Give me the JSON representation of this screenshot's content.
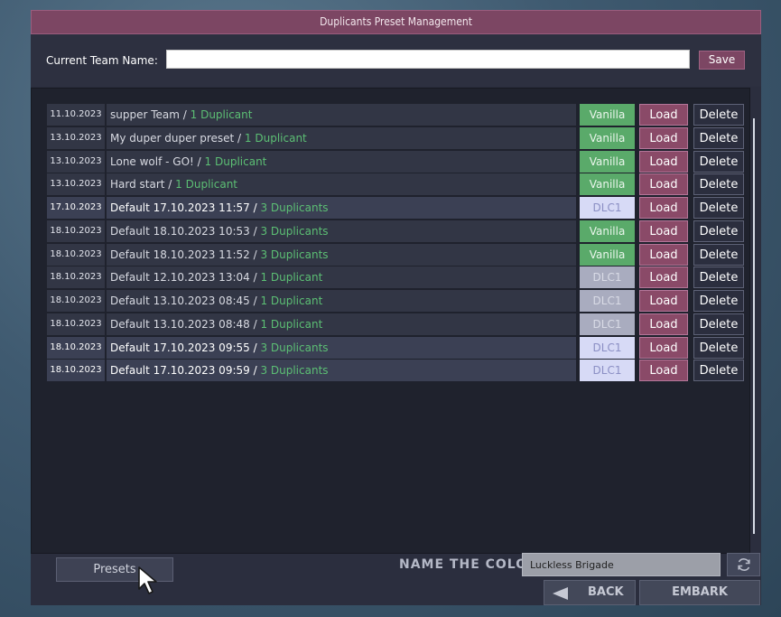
{
  "dialog": {
    "title": "Duplicants Preset Management",
    "team_label": "Current Team Name:",
    "team_value": "",
    "save_label": "Save"
  },
  "presets": [
    {
      "date": "11.10.2023",
      "name": "supper Team",
      "sep": " / ",
      "count": "1 Duplicant",
      "dlc": "Vanilla",
      "load": "Load",
      "delete": "Delete"
    },
    {
      "date": "13.10.2023",
      "name": "My duper duper preset",
      "sep": " / ",
      "count": "1 Duplicant",
      "dlc": "Vanilla",
      "load": "Load",
      "delete": "Delete"
    },
    {
      "date": "13.10.2023",
      "name": "Lone wolf - GO!",
      "sep": " / ",
      "count": "1 Duplicant",
      "dlc": "Vanilla",
      "load": "Load",
      "delete": "Delete"
    },
    {
      "date": "13.10.2023",
      "name": "Hard start",
      "sep": " / ",
      "count": "1 Duplicant",
      "dlc": "Vanilla",
      "load": "Load",
      "delete": "Delete"
    },
    {
      "date": "17.10.2023",
      "name": "Default 17.10.2023 11:57",
      "sep": " / ",
      "count": "3 Duplicants",
      "dlc": "DLC1",
      "load": "Load",
      "delete": "Delete"
    },
    {
      "date": "18.10.2023",
      "name": "Default 18.10.2023 10:53",
      "sep": " / ",
      "count": "3 Duplicants",
      "dlc": "Vanilla",
      "load": "Load",
      "delete": "Delete"
    },
    {
      "date": "18.10.2023",
      "name": "Default 18.10.2023 11:52",
      "sep": " / ",
      "count": "3 Duplicants",
      "dlc": "Vanilla",
      "load": "Load",
      "delete": "Delete"
    },
    {
      "date": "18.10.2023",
      "name": "Default 12.10.2023 13:04",
      "sep": " / ",
      "count": "1 Duplicant",
      "dlc": "DLC1",
      "load": "Load",
      "delete": "Delete"
    },
    {
      "date": "18.10.2023",
      "name": "Default 13.10.2023 08:45",
      "sep": " / ",
      "count": "1 Duplicant",
      "dlc": "DLC1",
      "load": "Load",
      "delete": "Delete"
    },
    {
      "date": "18.10.2023",
      "name": "Default 13.10.2023 08:48",
      "sep": " / ",
      "count": "1 Duplicant",
      "dlc": "DLC1",
      "load": "Load",
      "delete": "Delete"
    },
    {
      "date": "18.10.2023",
      "name": "Default 17.10.2023 09:55",
      "sep": " / ",
      "count": "3 Duplicants",
      "dlc": "DLC1",
      "load": "Load",
      "delete": "Delete"
    },
    {
      "date": "18.10.2023",
      "name": "Default 17.10.2023 09:59",
      "sep": " / ",
      "count": "3 Duplicants",
      "dlc": "DLC1",
      "load": "Load",
      "delete": "Delete"
    }
  ],
  "footer": {
    "presets_label": "Presets",
    "colony_label": "NAME THE COLONY",
    "colony_value": "Luckless Brigade",
    "back_label": "BACK",
    "embark_label": "EMBARK",
    "reroll_icon": "refresh-icon",
    "back_icon": "left-arrow-icon"
  },
  "colors": {
    "title_bar": "#7c4663",
    "vanilla": "#5aaa6a",
    "dlc1": "#d7daf6",
    "load": "#8a4a68",
    "count_text": "#5cbf74"
  }
}
